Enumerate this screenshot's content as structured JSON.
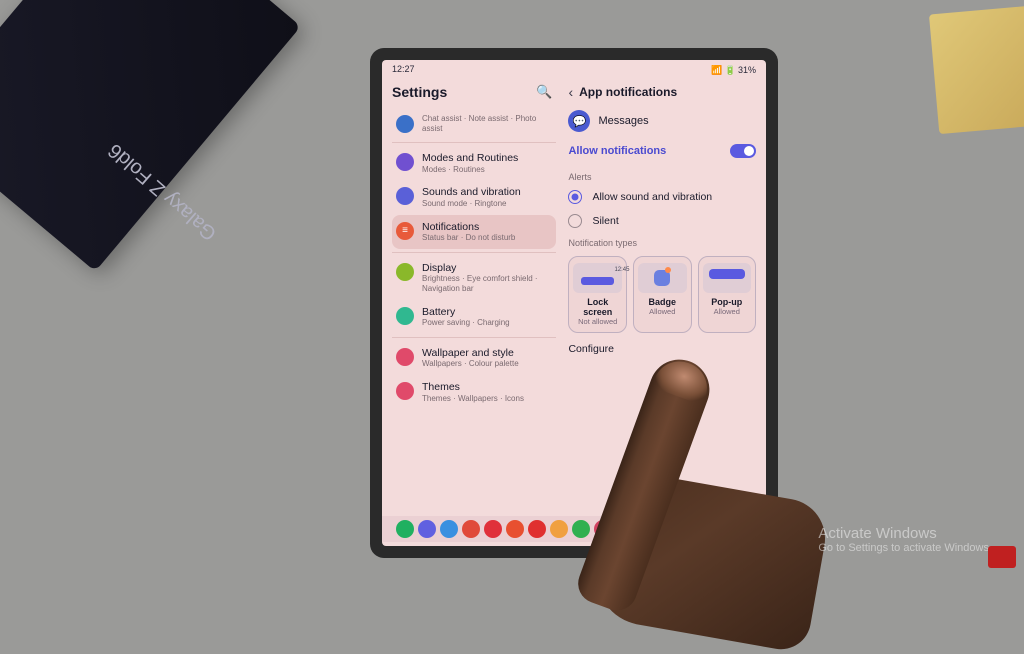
{
  "env": {
    "background_device": "Galaxy Z Fold6",
    "watermark": {
      "line1": "Activate Windows",
      "line2": "Go to Settings to activate Windows."
    }
  },
  "status": {
    "time": "12:27",
    "battery": "31%",
    "icons": "📶 🔋"
  },
  "settings": {
    "title": "Settings",
    "items": [
      {
        "name": "Chat assist",
        "sub": "Chat assist · Note assist · Photo assist",
        "color": "#3a70c8"
      },
      {
        "name": "Modes and Routines",
        "sub": "Modes · Routines",
        "color": "#7050d0"
      },
      {
        "name": "Sounds and vibration",
        "sub": "Sound mode · Ringtone",
        "color": "#5a60d8"
      },
      {
        "name": "Notifications",
        "sub": "Status bar · Do not disturb",
        "color": "#e85a3a",
        "glyph": "≡",
        "selected": true
      },
      {
        "name": "Display",
        "sub": "Brightness · Eye comfort shield · Navigation bar",
        "color": "#8ab82a"
      },
      {
        "name": "Battery",
        "sub": "Power saving · Charging",
        "color": "#30b890"
      },
      {
        "name": "Wallpaper and style",
        "sub": "Wallpapers · Colour palette",
        "color": "#e04a6a"
      },
      {
        "name": "Themes",
        "sub": "Themes · Wallpapers · Icons",
        "color": "#e04a6a"
      }
    ]
  },
  "detail": {
    "title": "App notifications",
    "app": {
      "name": "Messages"
    },
    "allow": {
      "label": "Allow notifications",
      "enabled": true
    },
    "alerts": {
      "heading": "Alerts",
      "options": [
        {
          "label": "Allow sound and vibration",
          "selected": true
        },
        {
          "label": "Silent",
          "selected": false
        }
      ]
    },
    "types": {
      "heading": "Notification types",
      "cards": [
        {
          "name": "Lock screen",
          "sub": "Not allowed",
          "preview_time": "12:45"
        },
        {
          "name": "Badge",
          "sub": "Allowed"
        },
        {
          "name": "Pop-up",
          "sub": "Allowed"
        }
      ]
    },
    "configure": "Configure"
  },
  "taskbar_colors": [
    "#20b060",
    "#6060e0",
    "#3a90e0",
    "#e04a3a",
    "#e0303a",
    "#e85030",
    "#e03030",
    "#f0a040",
    "#30b050",
    "#d04060",
    "#cccccc",
    "#cccccc"
  ]
}
